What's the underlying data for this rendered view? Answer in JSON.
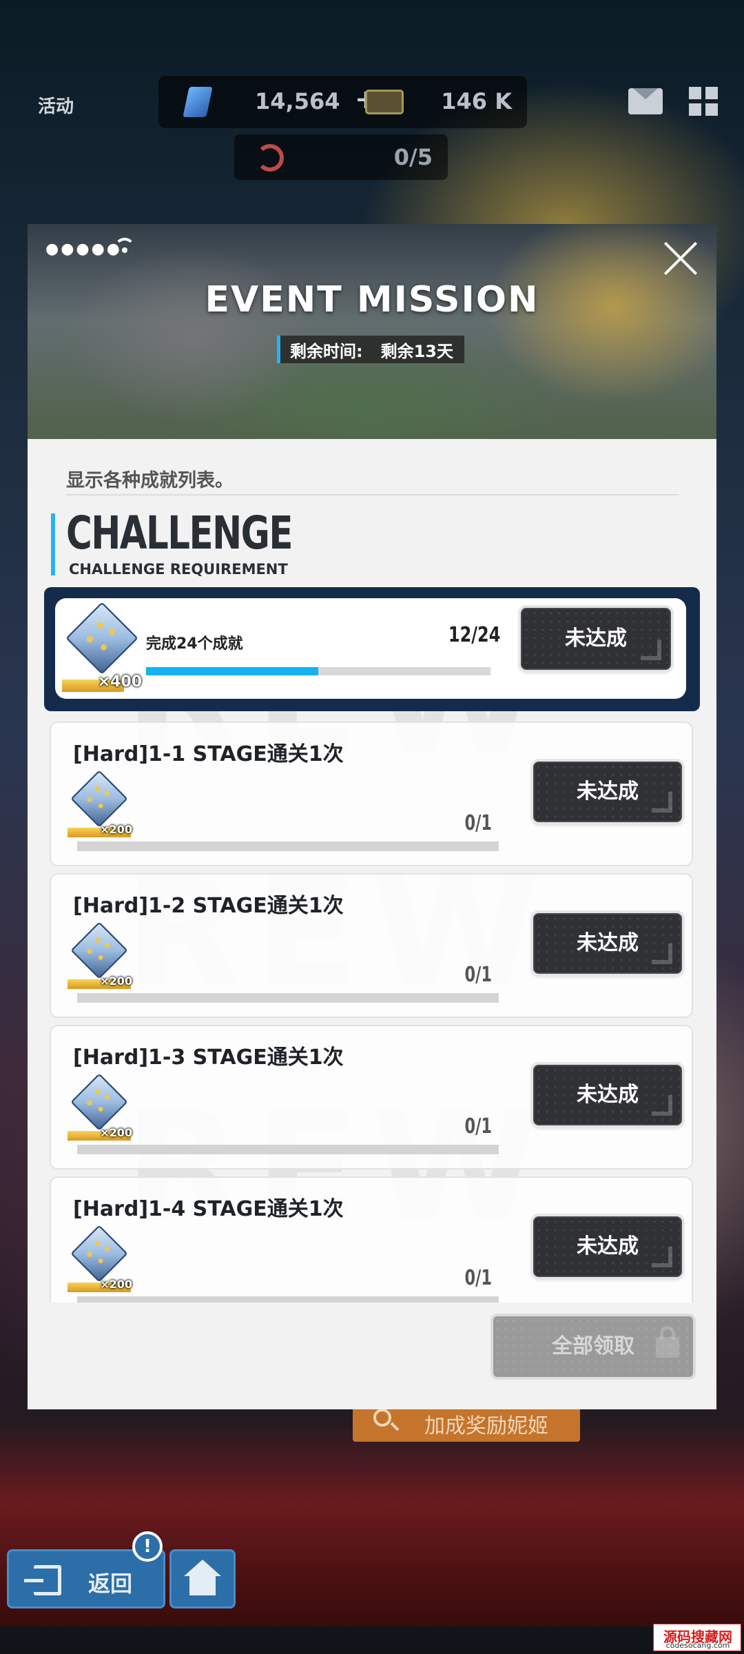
{
  "topbar": {
    "title": "活动",
    "currency_a": "14,564",
    "currency_plus": "+",
    "currency_b": "146 K",
    "sub_counter": "0/5"
  },
  "background": {
    "search_label": "加成奖励妮姬",
    "back_label": "返回",
    "notice_badge": "!"
  },
  "modal": {
    "status_dots": "●●●●●",
    "title": "EVENT MISSION",
    "timer_label": "剩余时间:",
    "timer_value": "剩余13天",
    "description": "显示各种成就列表。",
    "section_title": "CHALLENGE",
    "section_subtitle": "CHALLENGE REQUIREMENT",
    "watermark": "REW"
  },
  "featured": {
    "label": "完成24个成就",
    "progress_text": "12/24",
    "progress_fraction": 0.5,
    "reward_qty": "×400",
    "status_button": "未达成"
  },
  "missions": [
    {
      "title": "[Hard]1-1 STAGE通关1次",
      "reward_qty": "×200",
      "progress": "0/1",
      "progress_fraction": 0,
      "status_button": "未达成"
    },
    {
      "title": "[Hard]1-2 STAGE通关1次",
      "reward_qty": "×200",
      "progress": "0/1",
      "progress_fraction": 0,
      "status_button": "未达成"
    },
    {
      "title": "[Hard]1-3 STAGE通关1次",
      "reward_qty": "×200",
      "progress": "0/1",
      "progress_fraction": 0,
      "status_button": "未达成"
    },
    {
      "title": "[Hard]1-4 STAGE通关1次",
      "reward_qty": "×200",
      "progress": "0/1",
      "progress_fraction": 0,
      "status_button": "未达成"
    }
  ],
  "footer": {
    "claim_all": "全部领取"
  },
  "site_mark": {
    "top": "源码搜藏网",
    "bottom": "codesocang.com"
  },
  "colors": {
    "accent": "#14b2f0",
    "featured_bg": "#152b4c",
    "button_dark": "#2f3135",
    "claim_disabled": "#9a9a9a"
  }
}
